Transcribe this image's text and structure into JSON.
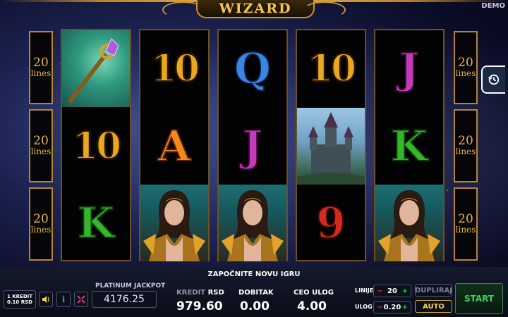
{
  "header": {
    "title": "WIZARD",
    "mode_badge": "DEMO"
  },
  "lines_indicator": {
    "left": [
      "20",
      "20",
      "20"
    ],
    "right": [
      "20",
      "20",
      "20"
    ],
    "word": "lines"
  },
  "reels": [
    [
      "staff",
      "10",
      "K"
    ],
    [
      "10",
      "A",
      "witch"
    ],
    [
      "Q",
      "J",
      "witch"
    ],
    [
      "10",
      "castle",
      "9"
    ],
    [
      "J",
      "K",
      "witch"
    ]
  ],
  "panel": {
    "message": "ZAPOČNITE NOVU IGRU",
    "kredit_line1": "1 KREDIT",
    "kredit_line2": "0.10 RSD",
    "jackpot_label": "PLATINUM JACKPOT",
    "jackpot_value": "4176.25",
    "kredit_label": "KREDIT",
    "currency": "RSD",
    "kredit_value": "979.60",
    "dobitak_label": "DOBITAK",
    "dobitak_value": "0.00",
    "ceo_ulog_label": "CEO ULOG",
    "ceo_ulog_value": "4.00",
    "linije_label": "LINIJE",
    "linije_value": "20",
    "ulog_label": "ULOG",
    "ulog_value": "0.20",
    "dupliraj_label": "DUPLIRAJ",
    "auto_label": "AUTO",
    "start_label": "START"
  },
  "colors": {
    "gold": "#e9b640",
    "start_green": "#37d060",
    "auto_yellow": "#f0d24a"
  }
}
